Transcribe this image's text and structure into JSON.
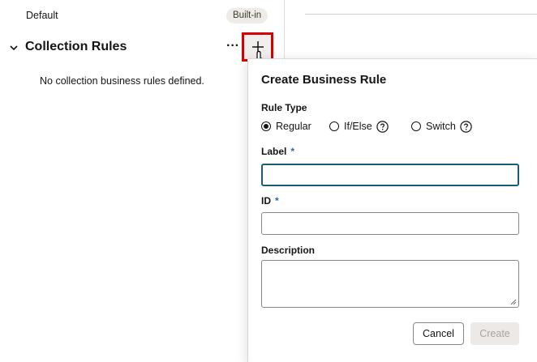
{
  "list": {
    "default_item": {
      "label": "Default",
      "badge": "Built-in"
    },
    "section": {
      "title": "Collection Rules",
      "more_label": "···",
      "empty_message": "No collection business rules defined."
    }
  },
  "icons": {
    "chevron": "chevron-down-icon",
    "more": "more-options-icon",
    "add": "plus-icon",
    "help": "help-circle-icon",
    "cursor": "hand-pointer-icon"
  },
  "dialog": {
    "title": "Create Business Rule",
    "rule_type": {
      "label": "Rule Type",
      "options": [
        "Regular",
        "If/Else",
        "Switch"
      ],
      "selected": "Regular"
    },
    "fields": {
      "label": {
        "label": "Label",
        "required_mark": "*",
        "value": ""
      },
      "id": {
        "label": "ID",
        "required_mark": "*",
        "value": ""
      },
      "description": {
        "label": "Description",
        "value": ""
      }
    },
    "buttons": {
      "cancel": "Cancel",
      "create": "Create"
    }
  },
  "colors": {
    "highlight_border": "#d60000",
    "focus_border": "#1d5a76",
    "required_mark": "#2b6cb0",
    "disabled_button_bg": "#ece9e6"
  }
}
